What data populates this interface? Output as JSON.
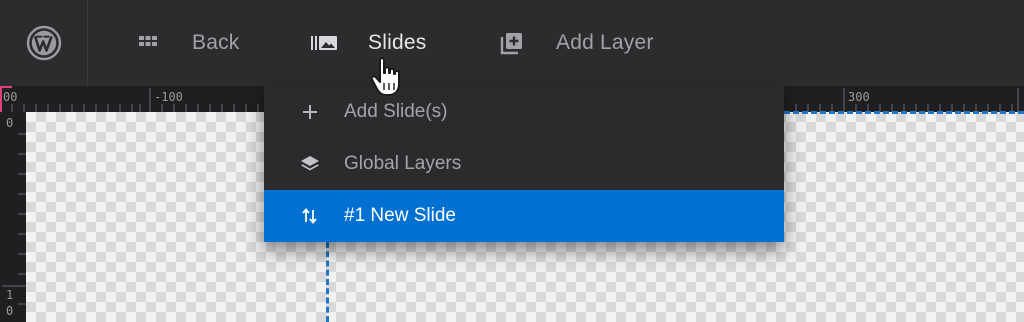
{
  "toolbar": {
    "back_label": "Back",
    "slides_label": "Slides",
    "add_layer_label": "Add Layer",
    "icons": {
      "wordpress": "wordpress-logo",
      "back": "grid-icon",
      "slides": "slides-gallery-icon",
      "add_layer": "add-layer-icon"
    }
  },
  "ruler": {
    "h_labels": [
      "00",
      "-100",
      "300"
    ],
    "v_labels": [
      "0",
      "1",
      "0"
    ]
  },
  "menu": {
    "items": [
      {
        "label": "Add Slide(s)",
        "icon": "plus-icon",
        "selected": false
      },
      {
        "label": "Global Layers",
        "icon": "layers-icon",
        "selected": false
      },
      {
        "label": "#1 New Slide",
        "icon": "sort-arrows-icon",
        "selected": true
      }
    ]
  },
  "colors": {
    "toolbar_bg": "#2c2c2e",
    "menu_bg": "#2b2b2e",
    "selected_bg": "#0070d2",
    "guide_blue": "#1e78c8",
    "ruler_origin_pink": "#e0407a"
  }
}
